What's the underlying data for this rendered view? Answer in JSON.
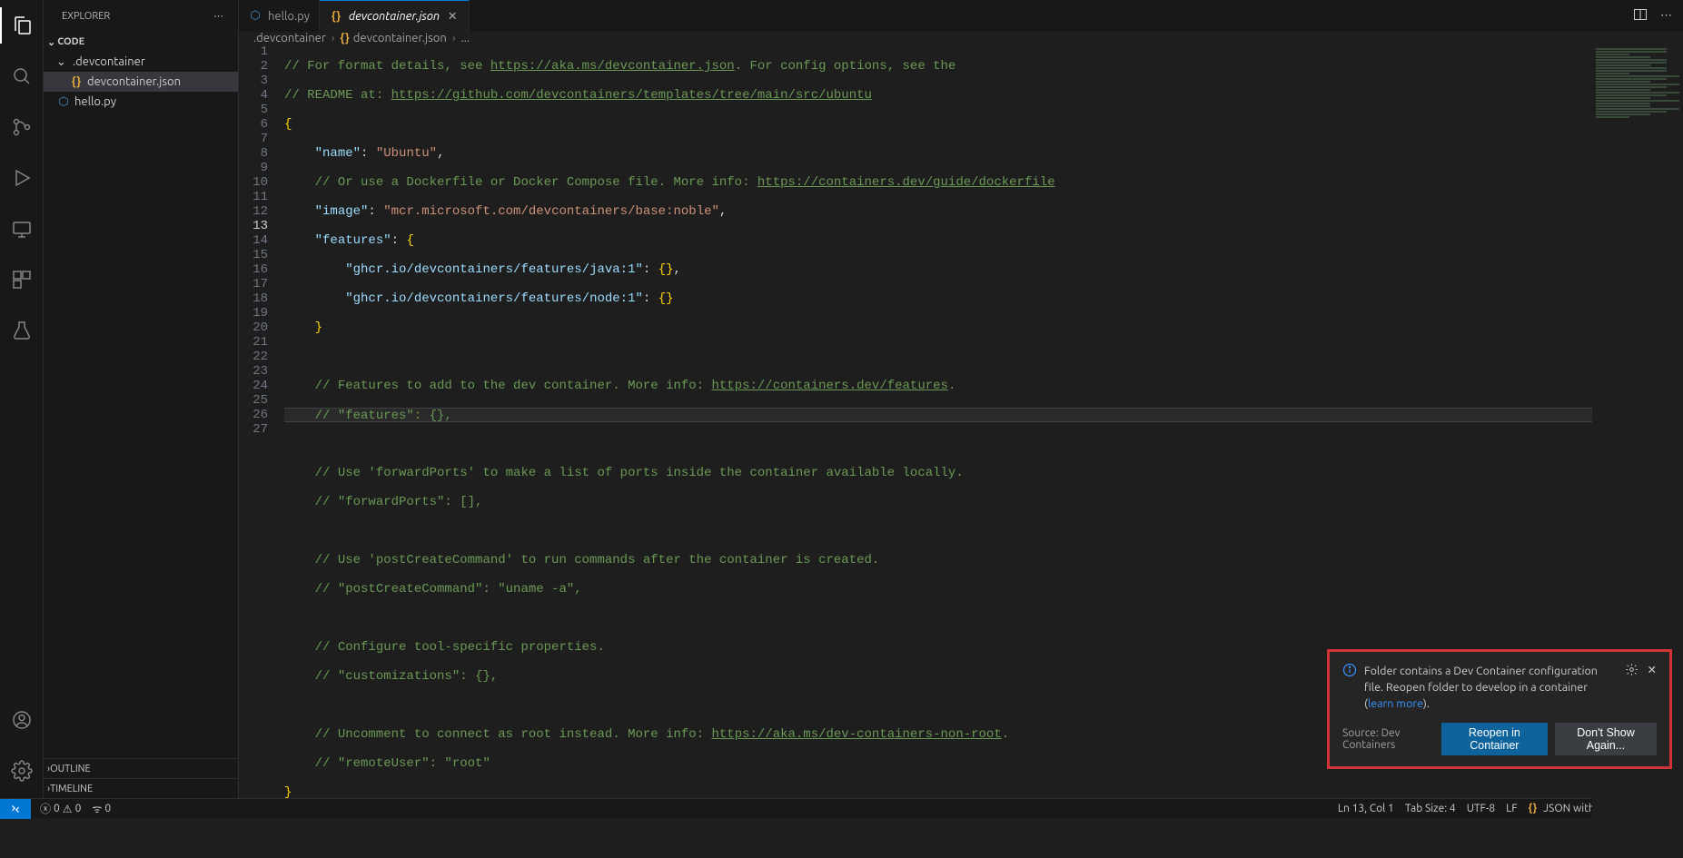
{
  "sidebar": {
    "title": "EXPLORER",
    "root": "CODE",
    "folder": ".devcontainer",
    "files": {
      "devcontainer": "devcontainer.json",
      "hello": "hello.py"
    },
    "outline": "OUTLINE",
    "timeline": "TIMELINE"
  },
  "tabs": {
    "hello": "hello.py",
    "dev": "devcontainer.json"
  },
  "breadcrumb": {
    "a": ".devcontainer",
    "b": "devcontainer.json",
    "c": "..."
  },
  "code": {
    "l1a": "// For format details, see ",
    "l1b": "https://aka.ms/devcontainer.json",
    "l1c": ". For config options, see the",
    "l2a": "// README at: ",
    "l2b": "https://github.com/devcontainers/templates/tree/main/src/ubuntu",
    "l3": "{",
    "l4_k": "\"name\"",
    "l4_v": "\"Ubuntu\"",
    "l5a": "// Or use a Dockerfile or Docker Compose file. More info: ",
    "l5b": "https://containers.dev/guide/dockerfile",
    "l6_k": "\"image\"",
    "l6_v": "\"mcr.microsoft.com/devcontainers/base:noble\"",
    "l7_k": "\"features\"",
    "l8_k": "\"ghcr.io/devcontainers/features/java:1\"",
    "l9_k": "\"ghcr.io/devcontainers/features/node:1\"",
    "l12a": "// Features to add to the dev container. More info: ",
    "l12b": "https://containers.dev/features",
    "l13": "// \"features\": {},",
    "l15": "// Use 'forwardPorts' to make a list of ports inside the container available locally.",
    "l16": "// \"forwardPorts\": [],",
    "l18": "// Use 'postCreateCommand' to run commands after the container is created.",
    "l19": "// \"postCreateCommand\": \"uname -a\",",
    "l21": "// Configure tool-specific properties.",
    "l22": "// \"customizations\": {},",
    "l24a": "// Uncomment to connect as root instead. More info: ",
    "l24b": "https://aka.ms/dev-containers-non-root",
    "l25": "// \"remoteUser\": \"root\"",
    "l26": "}"
  },
  "notification": {
    "message_a": "Folder contains a Dev Container configuration file. Reopen folder to develop in a container (",
    "link": "learn more",
    "message_b": ").",
    "source": "Source: Dev Containers",
    "primary": "Reopen in Container",
    "secondary": "Don't Show Again..."
  },
  "status": {
    "errors": "0",
    "warnings": "0",
    "ports": "0",
    "lncol": "Ln 13, Col 1",
    "tabsize": "Tab Size: 4",
    "encoding": "UTF-8",
    "eol": "LF",
    "lang": "JSON with Comments"
  }
}
